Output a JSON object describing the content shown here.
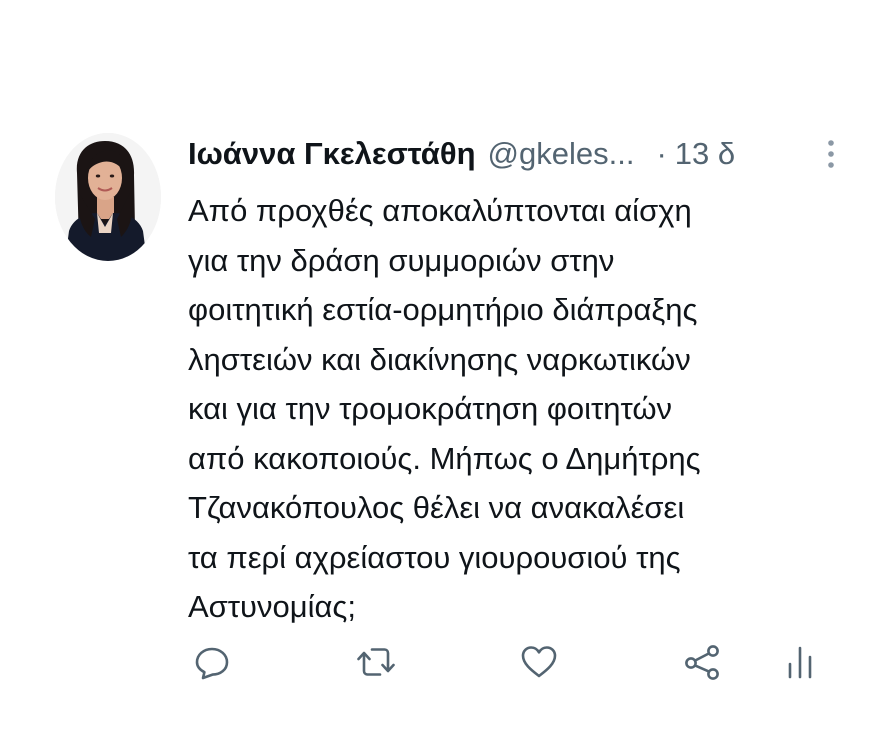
{
  "tweet": {
    "author": {
      "display_name": "Ιωάννα Γκελεστάθη",
      "handle": "@gkeles...",
      "avatar_icon": "user-avatar-photo"
    },
    "separator": "·",
    "time": "13 δ",
    "more_icon": "vertical-dots-icon",
    "text_lines": [
      "Από προχθές αποκαλύπτονται αίσχη",
      "για την δράση συμμοριών στην",
      "φοιτητική εστία-ορμητήριο διάπραξης",
      "ληστειών και διακίνησης ναρκωτικών",
      "και για την τρομοκράτηση φοιτητών",
      "από κακοποιούς. Μήπως ο Δημήτρης",
      "Τζανακόπουλος θέλει να ανακαλέσει",
      "τα περί αχρείαστου γιουρουσιού της",
      "Αστυνομίας;"
    ],
    "actions": [
      {
        "name": "reply",
        "icon": "reply-icon"
      },
      {
        "name": "retweet",
        "icon": "retweet-icon"
      },
      {
        "name": "like",
        "icon": "heart-icon"
      },
      {
        "name": "share",
        "icon": "share-icon"
      },
      {
        "name": "analytics",
        "icon": "analytics-icon"
      }
    ],
    "colors": {
      "text": "#0f1419",
      "secondary": "#536471",
      "icon": "#536471"
    }
  }
}
